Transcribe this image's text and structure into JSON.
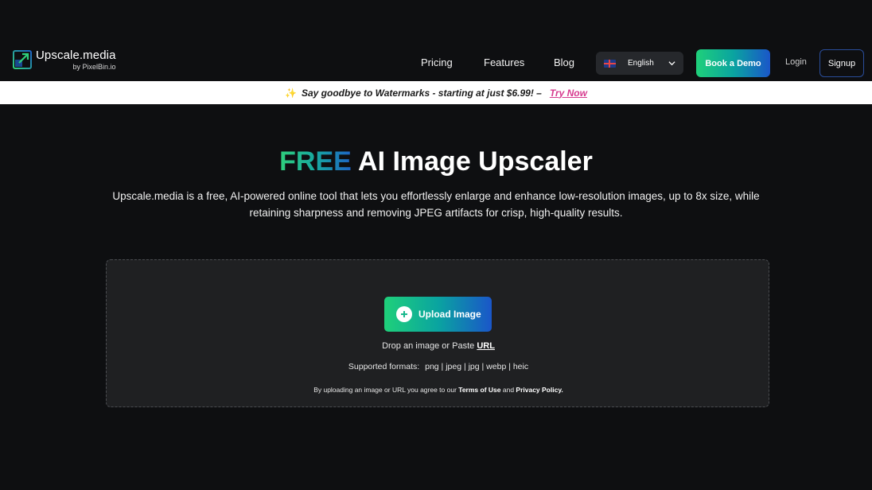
{
  "brand": {
    "name": "Upscale.media",
    "byline": "by PixelBin.io",
    "accent_green": "#1fd07a",
    "accent_blue": "#1a56c9",
    "icon": "logo-arrow-icon"
  },
  "nav": {
    "pricing": "Pricing",
    "features": "Features",
    "blog": "Blog",
    "language": "English",
    "language_icon": "uk-flag-icon",
    "book_demo": "Book a Demo",
    "login": "Login",
    "signup": "Signup"
  },
  "promo": {
    "icon": "sparkle-icon",
    "message": "Say goodbye to Watermarks - starting at just $6.99! –",
    "cta": "Try Now"
  },
  "hero": {
    "title_highlight": "FREE",
    "title_rest": " AI Image Upscaler",
    "description": "Upscale.media is a free, AI-powered online tool that lets you effortlessly enlarge and enhance low-resolution images, up to 8x size, while retaining sharpness and removing JPEG artifacts for crisp, high-quality results."
  },
  "upload": {
    "button_label": "Upload Image",
    "drop_prefix": "Drop an image or Paste ",
    "drop_link": "URL",
    "formats_label": "Supported formats:",
    "formats_list": "png | jpeg | jpg | webp | heic",
    "terms_prefix": "By uploading an image or URL you agree to our ",
    "terms_link": "Terms of Use",
    "terms_and": " and ",
    "privacy_link": "Privacy Policy."
  }
}
